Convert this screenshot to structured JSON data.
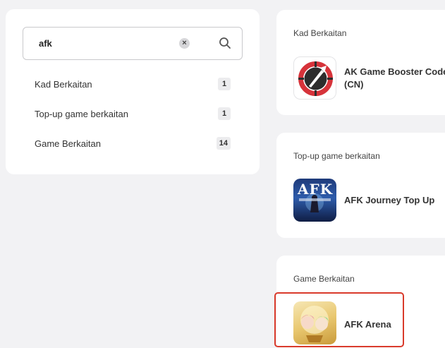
{
  "search": {
    "query": "afk",
    "clear_icon": "×"
  },
  "categories": [
    {
      "label": "Kad Berkaitan",
      "count": "1"
    },
    {
      "label": "Top-up game berkaitan",
      "count": "1"
    },
    {
      "label": "Game Berkaitan",
      "count": "14"
    }
  ],
  "sections": {
    "cards": {
      "title": "Kad Berkaitan",
      "items": [
        {
          "name": "AK Game Booster Code (CN)",
          "icon": "ak-booster-logo"
        }
      ]
    },
    "topup": {
      "title": "Top-up game berkaitan",
      "items": [
        {
          "name": "AFK Journey Top Up",
          "icon": "afk-journey-logo",
          "logo_text": "AFK"
        }
      ]
    },
    "games": {
      "title": "Game Berkaitan",
      "items": [
        {
          "name": "AFK Arena",
          "icon": "afk-arena-art"
        }
      ]
    }
  },
  "colors": {
    "highlight": "#d93a2b",
    "background": "#f2f2f4",
    "ak_red": "#d6333a"
  }
}
